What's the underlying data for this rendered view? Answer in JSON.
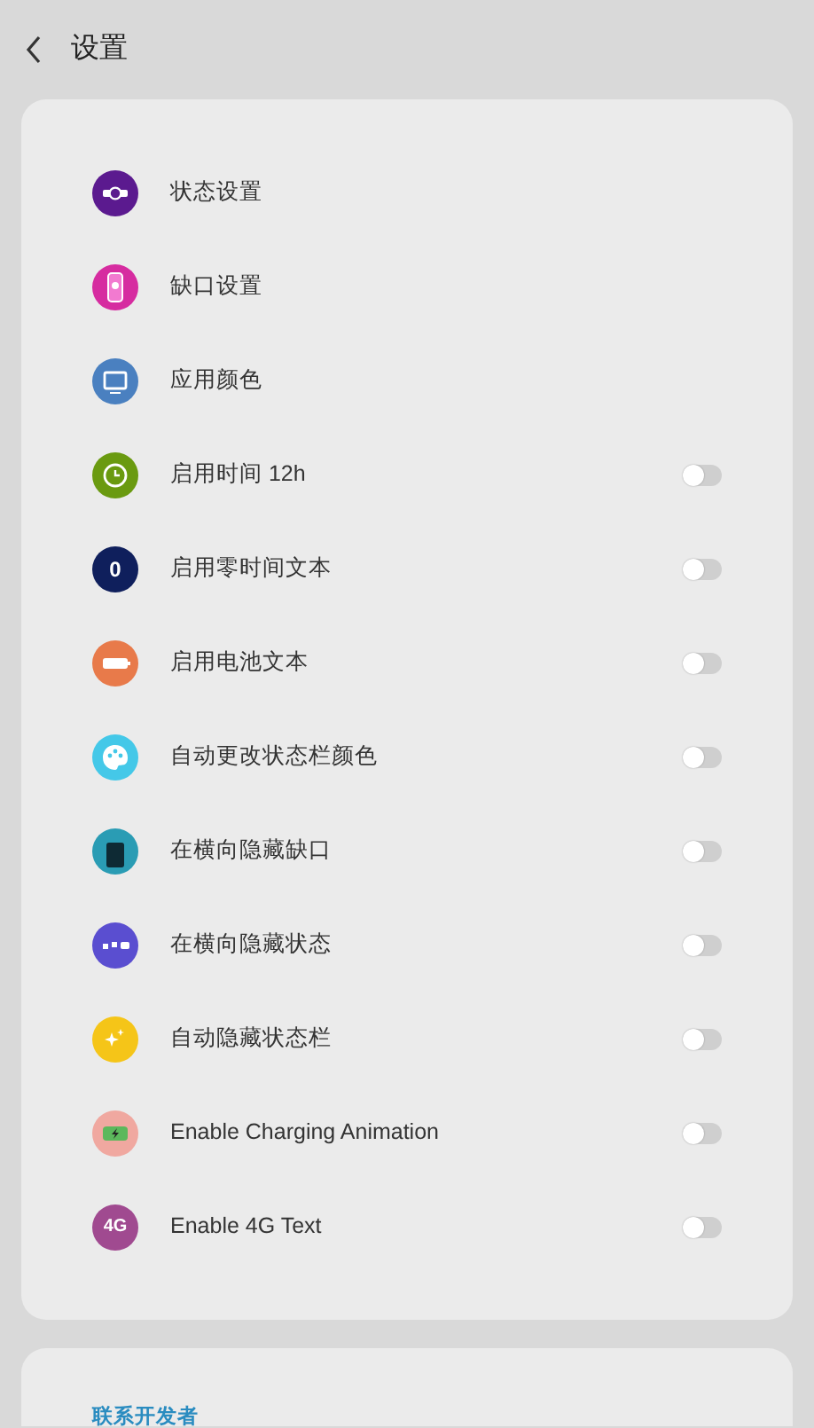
{
  "header": {
    "title": "设置"
  },
  "settings": [
    {
      "kind": "link",
      "label": "状态设置"
    },
    {
      "kind": "link",
      "label": "缺口设置"
    },
    {
      "kind": "link",
      "label": "应用颜色"
    },
    {
      "kind": "toggle",
      "label": "启用时间 12h",
      "on": false
    },
    {
      "kind": "toggle",
      "label": "启用零时间文本",
      "icon_text": "0",
      "on": false
    },
    {
      "kind": "toggle",
      "label": "启用电池文本",
      "on": false
    },
    {
      "kind": "toggle",
      "label": "自动更改状态栏颜色",
      "on": false
    },
    {
      "kind": "toggle",
      "label": "在横向隐藏缺口",
      "on": false
    },
    {
      "kind": "toggle",
      "label": "在横向隐藏状态",
      "on": false
    },
    {
      "kind": "toggle",
      "label": "自动隐藏状态栏",
      "on": false
    },
    {
      "kind": "toggle",
      "label": "Enable Charging Animation",
      "on": false
    },
    {
      "kind": "toggle",
      "label": "Enable 4G Text",
      "icon_text": "4G",
      "on": false
    }
  ],
  "contact": {
    "title": "联系开发者"
  }
}
